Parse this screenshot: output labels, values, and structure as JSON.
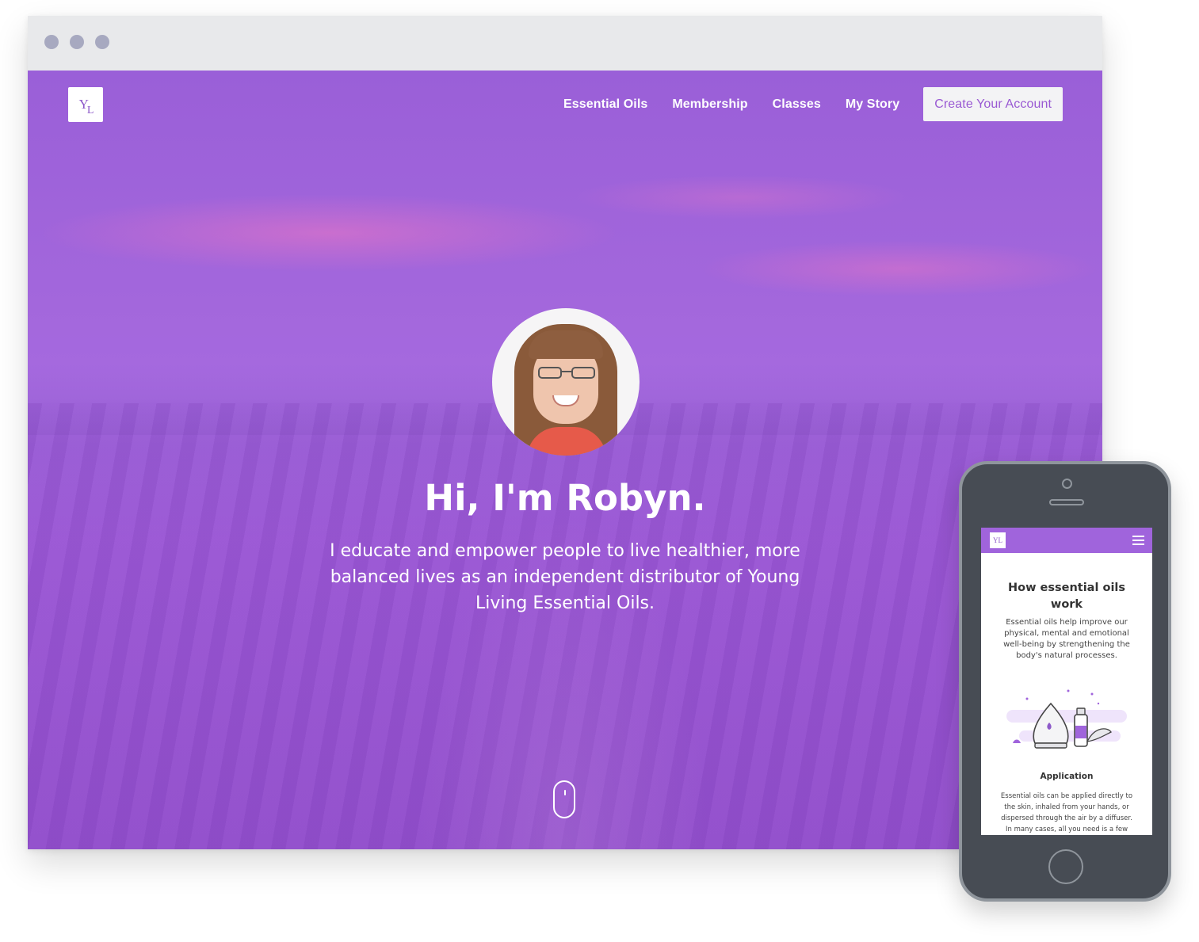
{
  "nav": {
    "logo_text": "YL",
    "items": [
      {
        "label": "Essential Oils"
      },
      {
        "label": "Membership"
      },
      {
        "label": "Classes"
      },
      {
        "label": "My Story"
      }
    ],
    "cta_label": "Create Your Account"
  },
  "hero": {
    "title": "Hi, I'm Robyn.",
    "text": "I educate and empower people to live healthier, more balanced lives as an independent distributor of Young Living Essential Oils.",
    "scroll_icon": "mouse-scroll-icon"
  },
  "mobile": {
    "logo_text": "YL",
    "menu_icon": "hamburger-menu-icon",
    "section_title": "How essential oils work",
    "section_text": "Essential oils help improve our physical, mental and emotional well-being by strengthening the body's natural processes.",
    "illustration": "diffuser-and-bottle-illustration",
    "subheading": "Application",
    "subtext": "Essential oils can be applied directly to the skin, inhaled from your hands, or dispersed through the air by a diffuser. In many cases, all you need is a few drops"
  },
  "colors": {
    "brand_purple": "#a064dc",
    "cta_text": "#9a5ad3",
    "browser_chrome": "#e8e9eb",
    "phone_body": "#474c54"
  }
}
